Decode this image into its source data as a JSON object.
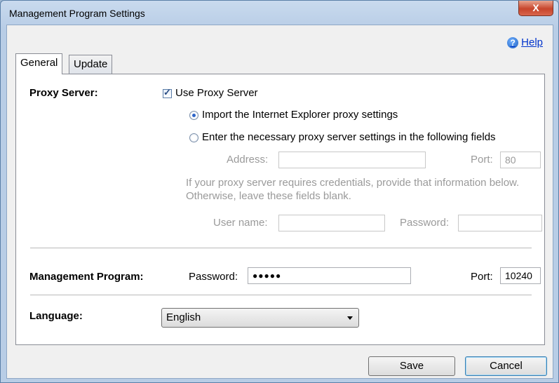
{
  "window": {
    "title": "Management Program Settings",
    "close_label": "X"
  },
  "help": {
    "label": "Help",
    "icon": "help-icon",
    "icon_glyph": "?"
  },
  "tabs": [
    {
      "label": "General",
      "active": true
    },
    {
      "label": "Update",
      "active": false
    }
  ],
  "proxy": {
    "section_label": "Proxy Server:",
    "use_proxy_label": "Use Proxy Server",
    "use_proxy_checked": true,
    "option_import_label": "Import the Internet Explorer proxy settings",
    "option_manual_label": "Enter the necessary proxy server settings in the following fields",
    "selected_option": "import",
    "address_label": "Address:",
    "address_value": "",
    "port_label": "Port:",
    "port_value": "80",
    "credentials_note": "If your proxy server requires credentials, provide that information below.  Otherwise, leave these fields blank.",
    "username_label": "User name:",
    "username_value": "",
    "password_label": "Password:",
    "password_value": ""
  },
  "management": {
    "section_label": "Management Program:",
    "password_label": "Password:",
    "password_mask": "●●●●●",
    "port_label": "Port:",
    "port_value": "10240"
  },
  "language": {
    "section_label": "Language:",
    "selected": "English"
  },
  "footer": {
    "save_label": "Save",
    "cancel_label": "Cancel"
  }
}
